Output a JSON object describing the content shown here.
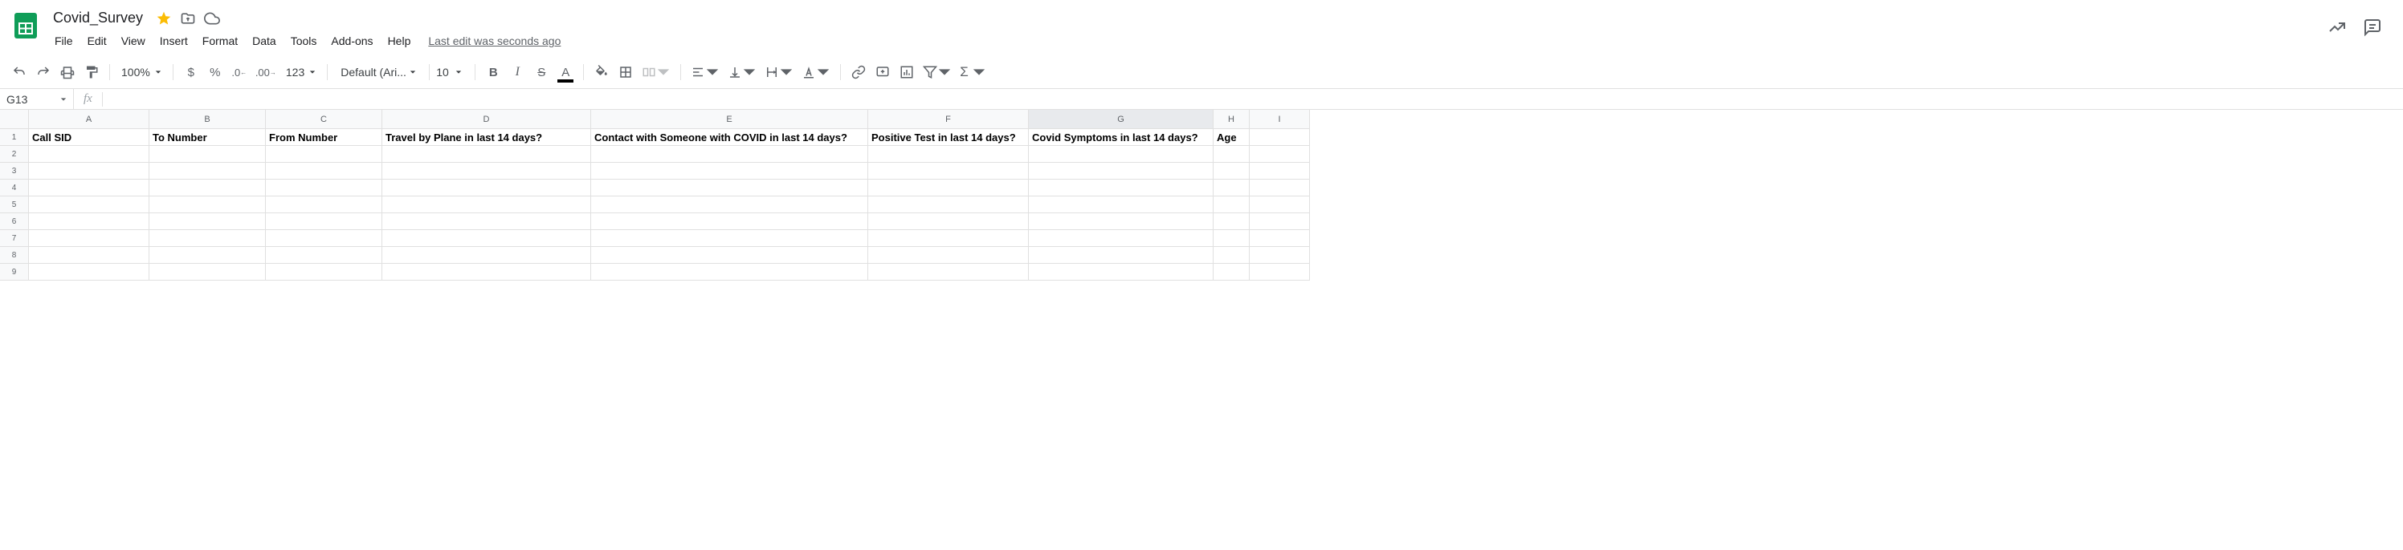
{
  "doc": {
    "title": "Covid_Survey"
  },
  "menu": {
    "file": "File",
    "edit": "Edit",
    "view": "View",
    "insert": "Insert",
    "format": "Format",
    "data": "Data",
    "tools": "Tools",
    "addons": "Add-ons",
    "help": "Help",
    "last_edit": "Last edit was seconds ago"
  },
  "toolbar": {
    "zoom": "100%",
    "font": "Default (Ari...",
    "font_size": "10",
    "more_formats": "123"
  },
  "namebox": {
    "ref": "G13"
  },
  "columns": [
    {
      "letter": "A",
      "cls": "cw-A"
    },
    {
      "letter": "B",
      "cls": "cw-B"
    },
    {
      "letter": "C",
      "cls": "cw-C"
    },
    {
      "letter": "D",
      "cls": "cw-D"
    },
    {
      "letter": "E",
      "cls": "cw-E"
    },
    {
      "letter": "F",
      "cls": "cw-F"
    },
    {
      "letter": "G",
      "cls": "cw-G"
    },
    {
      "letter": "H",
      "cls": "cw-H"
    },
    {
      "letter": "I",
      "cls": "cw-I"
    }
  ],
  "selected_col": "G",
  "row_count": 9,
  "headers": {
    "A": "Call SID",
    "B": "To Number",
    "C": "From Number",
    "D": "Travel by Plane in last 14 days?",
    "E": "Contact with Someone with COVID in last 14 days?",
    "F": "Positive Test in last 14 days?",
    "G": "Covid Symptoms in last 14 days?",
    "H": "Age",
    "I": ""
  }
}
